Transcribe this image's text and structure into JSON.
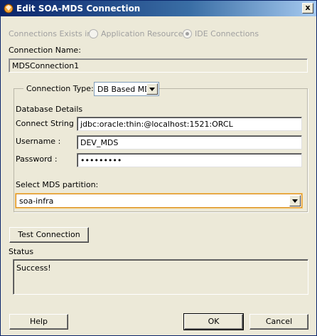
{
  "window": {
    "title": "Edit SOA-MDS Connection",
    "close_glyph": "x"
  },
  "connections_exists": {
    "label": "Connections Exists in:",
    "options": [
      {
        "label": "Application Resources",
        "selected": false
      },
      {
        "label": "IDE Connections",
        "selected": true
      }
    ]
  },
  "connection_name": {
    "label": "Connection Name:",
    "value": "MDSConnection1"
  },
  "connection_type": {
    "label": "Connection Type:",
    "value": "DB Based MDS"
  },
  "database_details": {
    "heading": "Database Details",
    "connect_string": {
      "label": "Connect String :",
      "value": "jdbc:oracle:thin:@localhost:1521:ORCL"
    },
    "username": {
      "label": "Username :",
      "value": "DEV_MDS"
    },
    "password": {
      "label": "Password :",
      "value": "•••••••••"
    }
  },
  "partition": {
    "label": "Select MDS partition:",
    "value": "soa-infra"
  },
  "test_button": {
    "label": "Test Connection"
  },
  "status": {
    "label": "Status",
    "value": "Success!"
  },
  "buttons": {
    "help": "Help",
    "ok": "OK",
    "cancel": "Cancel"
  }
}
